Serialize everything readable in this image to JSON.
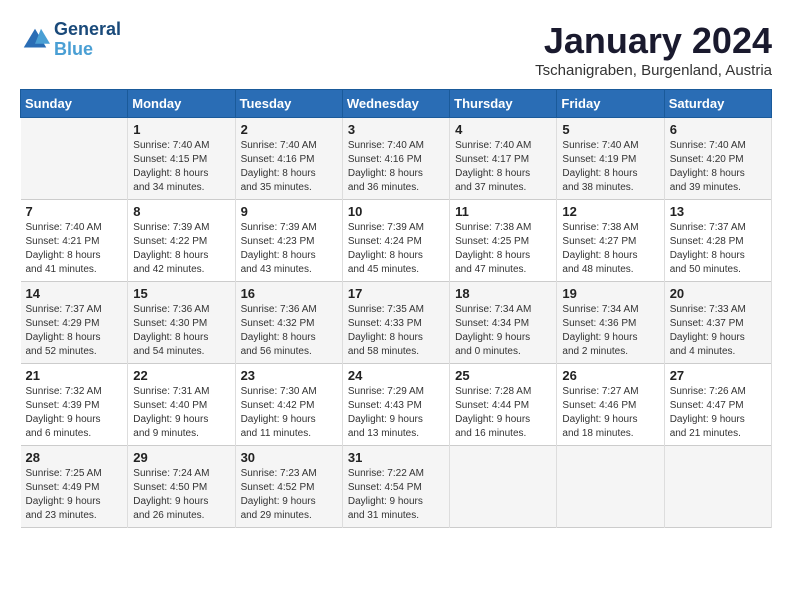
{
  "header": {
    "logo_line1": "General",
    "logo_line2": "Blue",
    "month": "January 2024",
    "location": "Tschanigraben, Burgenland, Austria"
  },
  "weekdays": [
    "Sunday",
    "Monday",
    "Tuesday",
    "Wednesday",
    "Thursday",
    "Friday",
    "Saturday"
  ],
  "weeks": [
    [
      {
        "day": null,
        "content": ""
      },
      {
        "day": "1",
        "content": "Sunrise: 7:40 AM\nSunset: 4:15 PM\nDaylight: 8 hours\nand 34 minutes."
      },
      {
        "day": "2",
        "content": "Sunrise: 7:40 AM\nSunset: 4:16 PM\nDaylight: 8 hours\nand 35 minutes."
      },
      {
        "day": "3",
        "content": "Sunrise: 7:40 AM\nSunset: 4:16 PM\nDaylight: 8 hours\nand 36 minutes."
      },
      {
        "day": "4",
        "content": "Sunrise: 7:40 AM\nSunset: 4:17 PM\nDaylight: 8 hours\nand 37 minutes."
      },
      {
        "day": "5",
        "content": "Sunrise: 7:40 AM\nSunset: 4:19 PM\nDaylight: 8 hours\nand 38 minutes."
      },
      {
        "day": "6",
        "content": "Sunrise: 7:40 AM\nSunset: 4:20 PM\nDaylight: 8 hours\nand 39 minutes."
      }
    ],
    [
      {
        "day": "7",
        "content": "Sunrise: 7:40 AM\nSunset: 4:21 PM\nDaylight: 8 hours\nand 41 minutes."
      },
      {
        "day": "8",
        "content": "Sunrise: 7:39 AM\nSunset: 4:22 PM\nDaylight: 8 hours\nand 42 minutes."
      },
      {
        "day": "9",
        "content": "Sunrise: 7:39 AM\nSunset: 4:23 PM\nDaylight: 8 hours\nand 43 minutes."
      },
      {
        "day": "10",
        "content": "Sunrise: 7:39 AM\nSunset: 4:24 PM\nDaylight: 8 hours\nand 45 minutes."
      },
      {
        "day": "11",
        "content": "Sunrise: 7:38 AM\nSunset: 4:25 PM\nDaylight: 8 hours\nand 47 minutes."
      },
      {
        "day": "12",
        "content": "Sunrise: 7:38 AM\nSunset: 4:27 PM\nDaylight: 8 hours\nand 48 minutes."
      },
      {
        "day": "13",
        "content": "Sunrise: 7:37 AM\nSunset: 4:28 PM\nDaylight: 8 hours\nand 50 minutes."
      }
    ],
    [
      {
        "day": "14",
        "content": "Sunrise: 7:37 AM\nSunset: 4:29 PM\nDaylight: 8 hours\nand 52 minutes."
      },
      {
        "day": "15",
        "content": "Sunrise: 7:36 AM\nSunset: 4:30 PM\nDaylight: 8 hours\nand 54 minutes."
      },
      {
        "day": "16",
        "content": "Sunrise: 7:36 AM\nSunset: 4:32 PM\nDaylight: 8 hours\nand 56 minutes."
      },
      {
        "day": "17",
        "content": "Sunrise: 7:35 AM\nSunset: 4:33 PM\nDaylight: 8 hours\nand 58 minutes."
      },
      {
        "day": "18",
        "content": "Sunrise: 7:34 AM\nSunset: 4:34 PM\nDaylight: 9 hours\nand 0 minutes."
      },
      {
        "day": "19",
        "content": "Sunrise: 7:34 AM\nSunset: 4:36 PM\nDaylight: 9 hours\nand 2 minutes."
      },
      {
        "day": "20",
        "content": "Sunrise: 7:33 AM\nSunset: 4:37 PM\nDaylight: 9 hours\nand 4 minutes."
      }
    ],
    [
      {
        "day": "21",
        "content": "Sunrise: 7:32 AM\nSunset: 4:39 PM\nDaylight: 9 hours\nand 6 minutes."
      },
      {
        "day": "22",
        "content": "Sunrise: 7:31 AM\nSunset: 4:40 PM\nDaylight: 9 hours\nand 9 minutes."
      },
      {
        "day": "23",
        "content": "Sunrise: 7:30 AM\nSunset: 4:42 PM\nDaylight: 9 hours\nand 11 minutes."
      },
      {
        "day": "24",
        "content": "Sunrise: 7:29 AM\nSunset: 4:43 PM\nDaylight: 9 hours\nand 13 minutes."
      },
      {
        "day": "25",
        "content": "Sunrise: 7:28 AM\nSunset: 4:44 PM\nDaylight: 9 hours\nand 16 minutes."
      },
      {
        "day": "26",
        "content": "Sunrise: 7:27 AM\nSunset: 4:46 PM\nDaylight: 9 hours\nand 18 minutes."
      },
      {
        "day": "27",
        "content": "Sunrise: 7:26 AM\nSunset: 4:47 PM\nDaylight: 9 hours\nand 21 minutes."
      }
    ],
    [
      {
        "day": "28",
        "content": "Sunrise: 7:25 AM\nSunset: 4:49 PM\nDaylight: 9 hours\nand 23 minutes."
      },
      {
        "day": "29",
        "content": "Sunrise: 7:24 AM\nSunset: 4:50 PM\nDaylight: 9 hours\nand 26 minutes."
      },
      {
        "day": "30",
        "content": "Sunrise: 7:23 AM\nSunset: 4:52 PM\nDaylight: 9 hours\nand 29 minutes."
      },
      {
        "day": "31",
        "content": "Sunrise: 7:22 AM\nSunset: 4:54 PM\nDaylight: 9 hours\nand 31 minutes."
      },
      {
        "day": null,
        "content": ""
      },
      {
        "day": null,
        "content": ""
      },
      {
        "day": null,
        "content": ""
      }
    ]
  ]
}
